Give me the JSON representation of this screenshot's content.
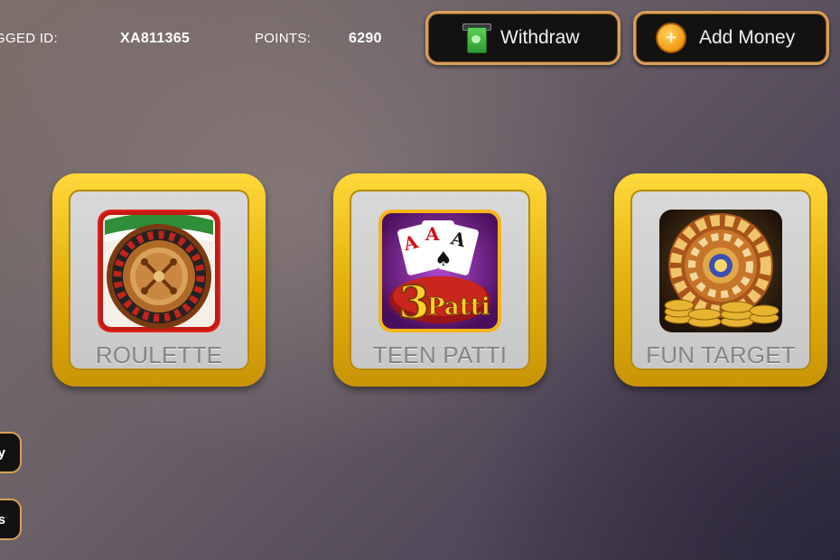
{
  "header": {
    "logged_id_label": "GGED ID:",
    "logged_id_value": "XA811365",
    "points_label": "POINTS:",
    "points_value": "6290",
    "withdraw_label": "Withdraw",
    "add_money_label": "Add Money",
    "withdraw_icon": "cash-icon",
    "add_money_icon": "plus-coin-icon"
  },
  "games": [
    {
      "title": "ROULETTE",
      "icon": "roulette-wheel-icon"
    },
    {
      "title": "TEEN PATTI",
      "icon": "teen-patti-cards-icon",
      "art_text": "Patti",
      "art_number": "3",
      "art_cards": "AAA"
    },
    {
      "title": "FUN TARGET",
      "icon": "fun-target-wheel-icon"
    }
  ],
  "side_buttons": [
    {
      "label": "y"
    },
    {
      "label": "s"
    }
  ],
  "colors": {
    "gold_frame": "#e3b20e",
    "button_border": "#d8a15a",
    "button_bg": "#141210",
    "card_title": "#858585"
  }
}
